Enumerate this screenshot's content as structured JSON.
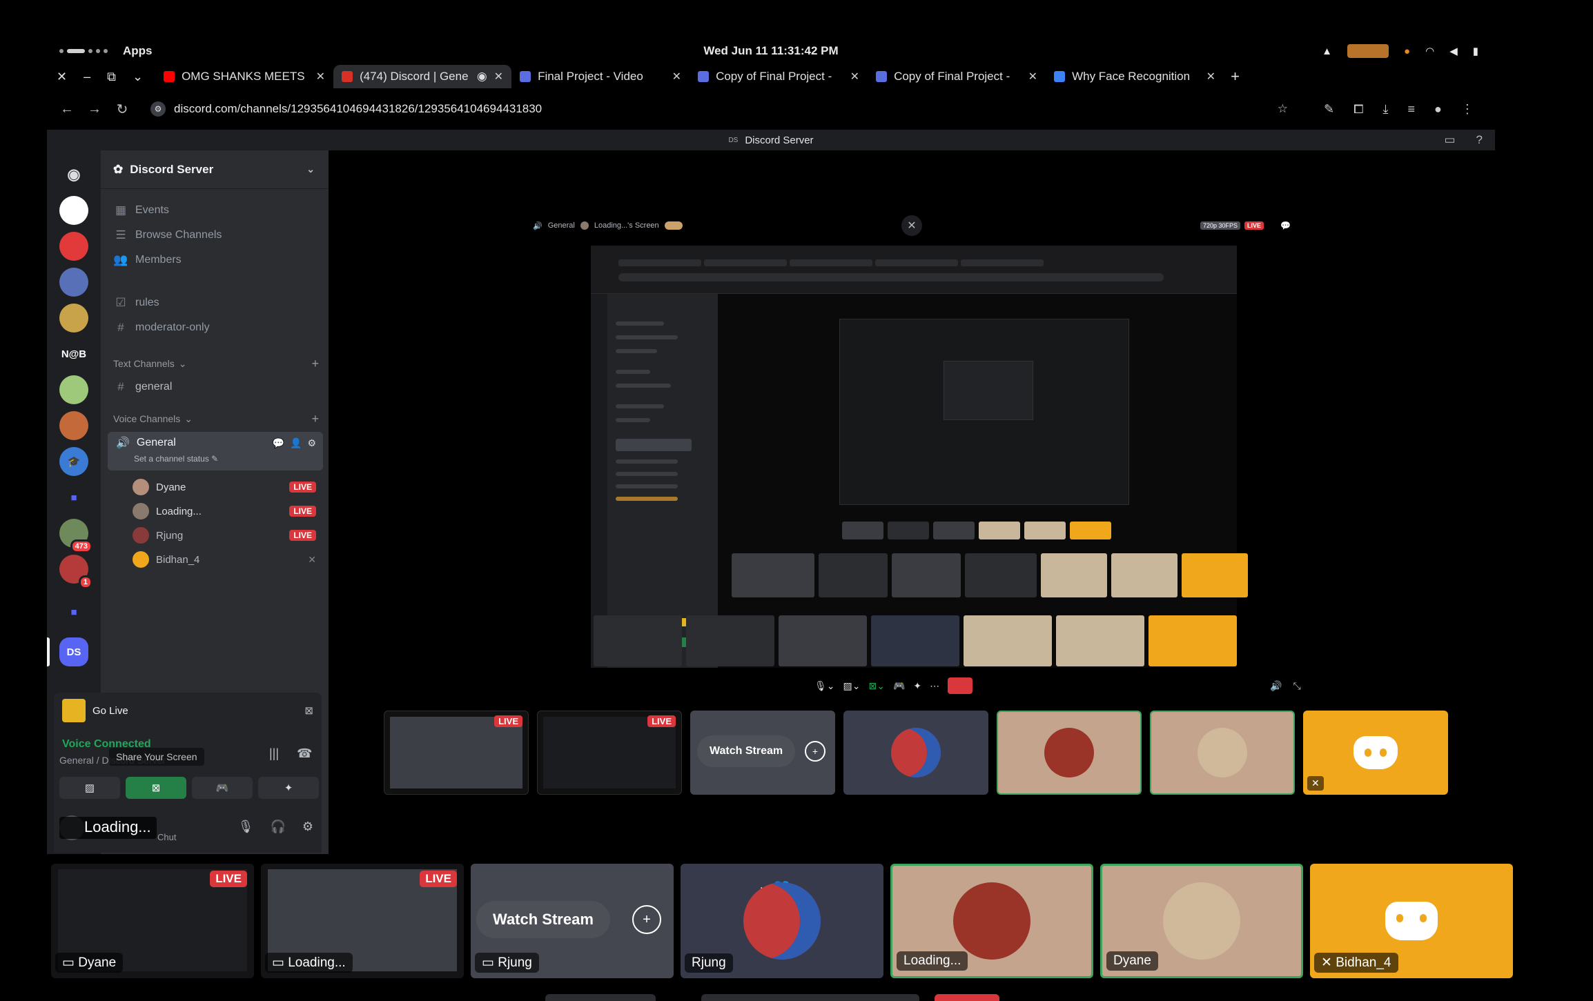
{
  "system": {
    "apps_label": "Apps",
    "clock": "Wed Jun 11  11:31:42 PM"
  },
  "browser": {
    "tabs": [
      {
        "title": "OMG SHANKS MEETS",
        "favicon_color": "#ff0000",
        "active": false
      },
      {
        "title": "(474) Discord | Gene",
        "favicon_color": "#d93025",
        "active": true
      },
      {
        "title": "Final Project - Video",
        "favicon_color": "#5b6ee1",
        "active": false
      },
      {
        "title": "Copy of Final Project -",
        "favicon_color": "#5b6ee1",
        "active": false
      },
      {
        "title": "Copy of Final Project -",
        "favicon_color": "#5b6ee1",
        "active": false
      },
      {
        "title": "Why Face Recognition",
        "favicon_color": "#3b82f6",
        "active": false
      }
    ],
    "url": "discord.com/channels/1293564104694431826/1293564104694431830"
  },
  "discord": {
    "window_title": "Discord Server",
    "window_badge": "DS",
    "server_name": "Discord Server",
    "server_rail": [
      {
        "label": "",
        "color": "#ffffff",
        "count": ""
      },
      {
        "label": "",
        "color": "#e23a3a",
        "count": ""
      },
      {
        "label": "",
        "color": "#5870b8",
        "count": ""
      },
      {
        "label": "",
        "color": "#c9a34a",
        "count": ""
      },
      {
        "label": "N@B",
        "color": "#1e1f22",
        "count": ""
      },
      {
        "label": "",
        "color": "#9fc97a",
        "count": ""
      },
      {
        "label": "",
        "color": "#c46a3a",
        "count": ""
      },
      {
        "label": "",
        "color": "#3a7bd5",
        "count": ""
      },
      {
        "label": "",
        "color": "#5865f2",
        "count": ""
      },
      {
        "label": "",
        "color": "#6e8a5a",
        "count": "473"
      },
      {
        "label": "",
        "color": "#b53a3a",
        "count": "1"
      },
      {
        "label": "",
        "color": "#5865f2",
        "count": ""
      },
      {
        "label": "DS",
        "color": "#5865f2",
        "count": ""
      }
    ],
    "nav": {
      "events": "Events",
      "browse": "Browse Channels",
      "members": "Members",
      "rules": "rules",
      "moderator": "moderator-only"
    },
    "text_category": "Text Channels",
    "text_channel": "general",
    "voice_category": "Voice Channels",
    "voice_channel": "General",
    "voice_status": "Set a channel status",
    "voice_users": [
      {
        "name": "Dyane",
        "live": "LIVE",
        "avatar_color": "#b58f7c"
      },
      {
        "name": "Loading...",
        "live": "LIVE",
        "avatar_color": "#8a7a6e"
      },
      {
        "name": "Rjung",
        "live": "LIVE",
        "avatar_color": "#8a3a3a"
      },
      {
        "name": "Bidhan_4",
        "live": "",
        "avatar_color": "#f0a71b"
      }
    ],
    "go_live": "Go Live",
    "voice_connected": "Voice Connected",
    "voice_location": "General / Discord Server",
    "tooltip": "Share Your Screen",
    "user_loading": "Loading...",
    "user_sub": "Chut"
  },
  "stage": {
    "header_channel": "General",
    "header_screen": "Loading...'s Screen",
    "quality": "720p 30FPS",
    "live": "LIVE",
    "strip": [
      {
        "type": "screen",
        "name": "Dyane",
        "live": "LIVE"
      },
      {
        "type": "screen",
        "name": "Loading...",
        "live": "LIVE"
      },
      {
        "type": "watch",
        "name": "Rjung",
        "button": "Watch Stream"
      },
      {
        "type": "cam",
        "name": "Rjung"
      },
      {
        "type": "avatar",
        "name": "Loading...",
        "speaking": true
      },
      {
        "type": "avatar",
        "name": "Dyane",
        "speaking": true
      },
      {
        "type": "discord",
        "name": "Bidhan_4"
      }
    ]
  },
  "bottom_strip": [
    {
      "type": "screen",
      "name": "Dyane",
      "live": "LIVE"
    },
    {
      "type": "screen",
      "name": "Loading...",
      "live": "LIVE"
    },
    {
      "type": "watch",
      "name": "Rjung",
      "button": "Watch Stream"
    },
    {
      "type": "cam",
      "name": "Rjung"
    },
    {
      "type": "avatar",
      "name": "Loading..."
    },
    {
      "type": "avatar",
      "name": "Dyane"
    },
    {
      "type": "discord",
      "name": "Bidhan_4"
    }
  ]
}
